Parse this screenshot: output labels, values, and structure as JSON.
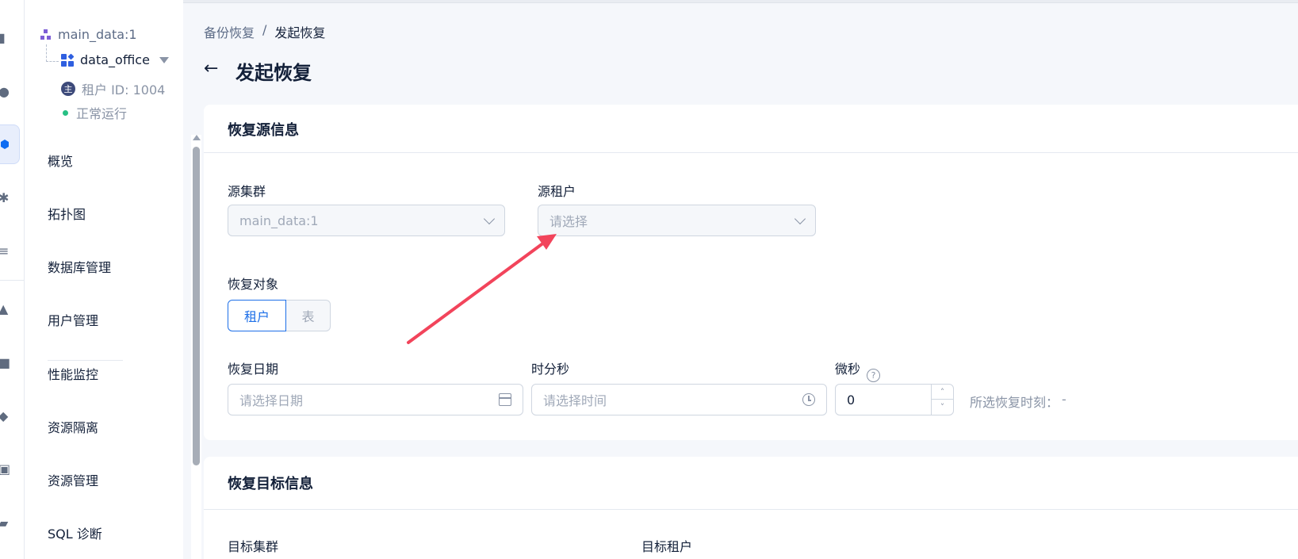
{
  "sidebar": {
    "tree": {
      "cluster": "main_data:1",
      "tenant": "data_office",
      "tenant_id": "租户 ID: 1004",
      "tenant_badge": "主",
      "status": "正常运行"
    },
    "menu": [
      "概览",
      "拓扑图",
      "数据库管理",
      "用户管理",
      "性能监控",
      "资源隔离",
      "资源管理",
      "SQL 诊断"
    ]
  },
  "breadcrumb": {
    "parent": "备份恢复",
    "separator": "/",
    "current": "发起恢复"
  },
  "page_title": "发起恢复",
  "source_card": {
    "title": "恢复源信息",
    "source_cluster_label": "源集群",
    "source_cluster_value": "main_data:1",
    "source_tenant_label": "源租户",
    "source_tenant_placeholder": "请选择",
    "restore_object_label": "恢复对象",
    "restore_object_options": [
      "租户",
      "表"
    ],
    "restore_date_label": "恢复日期",
    "restore_date_placeholder": "请选择日期",
    "time_label": "时分秒",
    "time_placeholder": "请选择时间",
    "microsecond_label": "微秒",
    "microsecond_value": "0",
    "selected_time_label": "所选恢复时刻：",
    "selected_time_value": "-"
  },
  "target_card": {
    "title": "恢复目标信息",
    "target_cluster_label": "目标集群",
    "target_tenant_label": "目标租户"
  },
  "colors": {
    "accent": "#1d6fe8",
    "status_ok": "#27c084",
    "arrow": "#f2445b"
  }
}
